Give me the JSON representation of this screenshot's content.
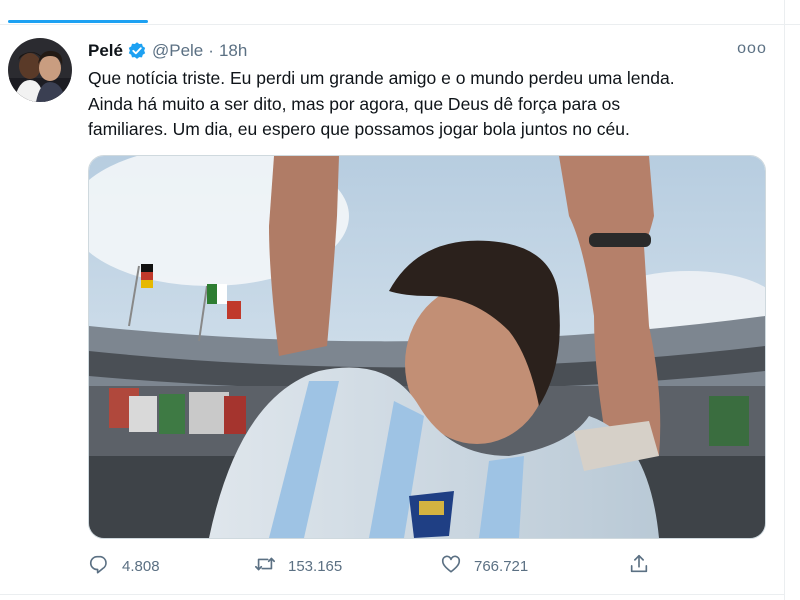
{
  "tweet": {
    "author_name": "Pelé",
    "handle": "@Pele",
    "separator": "·",
    "time": "18h",
    "more": "ooo",
    "text": "Que notícia triste. Eu perdi um grande amigo e o mundo perdeu uma lenda.\nAinda há muito a ser dito, mas por agora, que Deus dê força para os\nfamiliares. Um dia, eu espero que possamos jogar bola juntos no céu."
  },
  "actions": {
    "reply_count": "4.808",
    "retweet_count": "153.165",
    "like_count": "766.721"
  },
  "icons": {
    "verified": "verified-badge-icon",
    "more": "more-options-icon",
    "reply": "reply-icon",
    "retweet": "retweet-icon",
    "like": "heart-icon",
    "share": "share-icon"
  },
  "colors": {
    "accent": "#1da1f2",
    "muted": "#5b7083",
    "text": "#0f1419",
    "border": "#cfd9de"
  }
}
